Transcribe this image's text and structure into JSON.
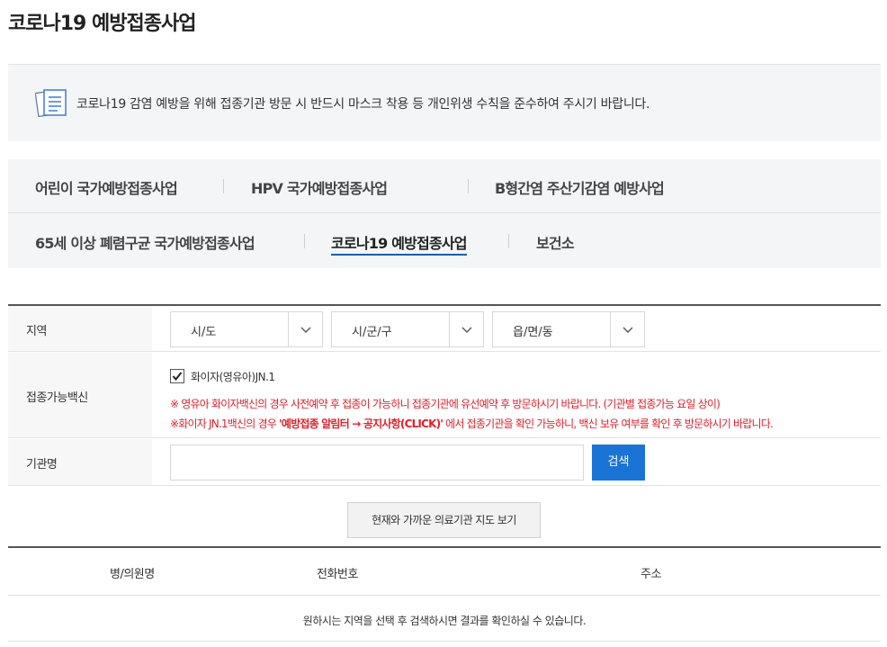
{
  "page": {
    "title": "코로나19 예방접종사업"
  },
  "notice": {
    "icon": "document-list-icon",
    "text": "코로나19 감염 예방을 위해 접종기관 방문 시 반드시 마스크 착용 등 개인위생 수칙을 준수하여 주시기 바랍니다."
  },
  "tabs": {
    "row1": [
      {
        "label": "어린이 국가예방접종사업"
      },
      {
        "label": "HPV 국가예방접종사업"
      },
      {
        "label": "B형간염 주산기감염 예방사업"
      }
    ],
    "row2": [
      {
        "label": "65세 이상 폐렴구균 국가예방접종사업"
      },
      {
        "label": "코로나19 예방접종사업",
        "active": true
      },
      {
        "label": "보건소"
      }
    ],
    "active_color": "#1a5fa8"
  },
  "form": {
    "region": {
      "label": "지역",
      "selects": [
        {
          "value": "시/도"
        },
        {
          "value": "시/군/구"
        },
        {
          "value": "읍/면/동"
        }
      ]
    },
    "vaccine": {
      "label": "접종가능백신",
      "checkbox_label": "화이자(영유아)JN.1",
      "checked": true,
      "warning1": "※ 영유아 화이자백신의 경우 사전예약 후 접종이 가능하니 접종기관에 유선예약 후 방문하시기 바랍니다. (기관별 접종가능 요일 상이)",
      "warning2_prefix": "※화이자 JN.1백신의 경우 ",
      "warning2_bold": "'예방접종 알림터 → 공지사항(CLICK)'",
      "warning2_suffix": " 에서 접종기관을 확인 가능하니, 백신 보유 여부를 확인 후 방문하시기 바랍니다.",
      "warning_color": "#e0202b"
    },
    "institution": {
      "label": "기관명",
      "value": "",
      "placeholder": "",
      "search_label": "검색"
    }
  },
  "map_button": {
    "label": "현재와 가까운 의료기관 지도 보기"
  },
  "results": {
    "columns": [
      "병/의원명",
      "전화번호",
      "주소"
    ],
    "empty_message": "원하시는 지역을 선택 후 검색하시면 결과를 확인하실 수 있습니다."
  },
  "colors": {
    "accent": "#1a74d6",
    "panel_bg": "#f4f5f7"
  }
}
